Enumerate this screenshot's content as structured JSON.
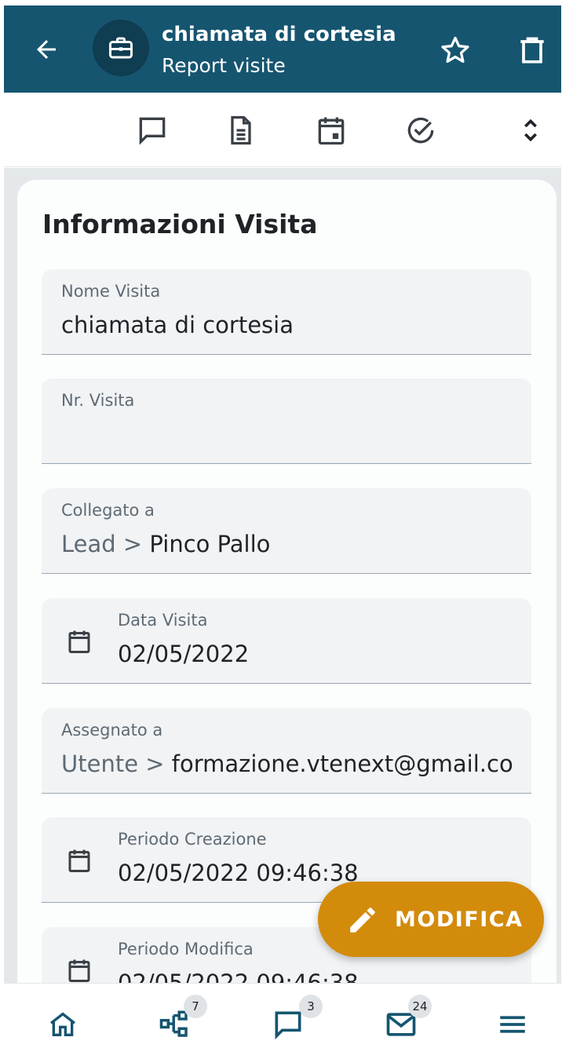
{
  "header": {
    "title": "chiamata di cortesia",
    "subtitle": "Report visite",
    "back_icon": "arrow-left-icon",
    "module_icon": "briefcase-icon",
    "star_icon": "star-outline-icon",
    "delete_icon": "trash-icon",
    "bg_color": "#165570"
  },
  "toolbar": {
    "icons": [
      "comment-icon",
      "document-icon",
      "calendar-event-icon",
      "check-circle-icon",
      "expand-collapse-icon"
    ]
  },
  "section": {
    "title": "Informazioni Visita"
  },
  "fields": {
    "nome_visita": {
      "label": "Nome Visita",
      "value": "chiamata di cortesia"
    },
    "nr_visita": {
      "label": "Nr. Visita",
      "value": ""
    },
    "collegato_a": {
      "label": "Collegato a",
      "prefix": "Lead > ",
      "value": "Pinco Pallo"
    },
    "data_visita": {
      "label": "Data Visita",
      "value": "02/05/2022"
    },
    "assegnato_a": {
      "label": "Assegnato a",
      "prefix": "Utente > ",
      "value": "formazione.vtenext@gmail.co"
    },
    "periodo_creazione": {
      "label": "Periodo Creazione",
      "value": "02/05/2022 09:46:38"
    },
    "periodo_modifica": {
      "label": "Periodo Modifica",
      "value": "02/05/2022 09:46:38"
    }
  },
  "fab": {
    "label": "MODIFICA",
    "icon": "pencil-icon",
    "color": "#d38b0c"
  },
  "bottom_nav": {
    "items": [
      {
        "icon": "home-icon",
        "badge": ""
      },
      {
        "icon": "hierarchy-icon",
        "badge": "7"
      },
      {
        "icon": "chat-icon",
        "badge": "3"
      },
      {
        "icon": "mail-icon",
        "badge": "24"
      },
      {
        "icon": "menu-icon",
        "badge": ""
      }
    ]
  }
}
